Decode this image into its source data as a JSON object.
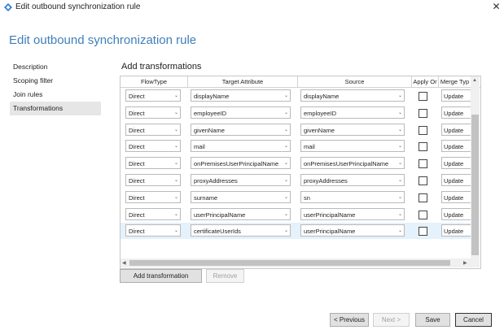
{
  "window": {
    "title": "Edit outbound synchronization rule",
    "close_glyph": "✕"
  },
  "page": {
    "heading": "Edit outbound synchronization rule"
  },
  "nav": {
    "items": [
      "Description",
      "Scoping filter",
      "Join rules",
      "Transformations"
    ],
    "active_index": 3
  },
  "section": {
    "title": "Add transformations"
  },
  "table": {
    "headers": [
      "FlowType",
      "Target Attribute",
      "Source",
      "Apply Or",
      "Merge Typ"
    ],
    "rows": [
      {
        "flow": "Direct",
        "target": "displayName",
        "source": "displayName",
        "merge": "Update"
      },
      {
        "flow": "Direct",
        "target": "employeeID",
        "source": "employeeID",
        "merge": "Update"
      },
      {
        "flow": "Direct",
        "target": "givenName",
        "source": "givenName",
        "merge": "Update"
      },
      {
        "flow": "Direct",
        "target": "mail",
        "source": "mail",
        "merge": "Update"
      },
      {
        "flow": "Direct",
        "target": "onPremisesUserPrincipalName",
        "source": "onPremisesUserPrincipalName",
        "merge": "Update"
      },
      {
        "flow": "Direct",
        "target": "proxyAddresses",
        "source": "proxyAddresses",
        "merge": "Update"
      },
      {
        "flow": "Direct",
        "target": "surname",
        "source": "sn",
        "merge": "Update"
      },
      {
        "flow": "Direct",
        "target": "userPrincipalName",
        "source": "userPrincipalName",
        "merge": "Update"
      },
      {
        "flow": "Direct",
        "target": "certificateUserIds",
        "source": "userPrincipalName",
        "merge": "Update"
      }
    ],
    "selected_row": 8
  },
  "buttons": {
    "add_transformation": "Add transformation",
    "remove": "Remove",
    "previous": "< Previous",
    "next": "Next >",
    "save": "Save",
    "cancel": "Cancel"
  },
  "icons": {
    "dropdown": "chevron-down-icon",
    "app": "diamond-app-icon"
  },
  "colors": {
    "accent": "#3f7fb9",
    "selected_row": "#e5f1fb"
  }
}
